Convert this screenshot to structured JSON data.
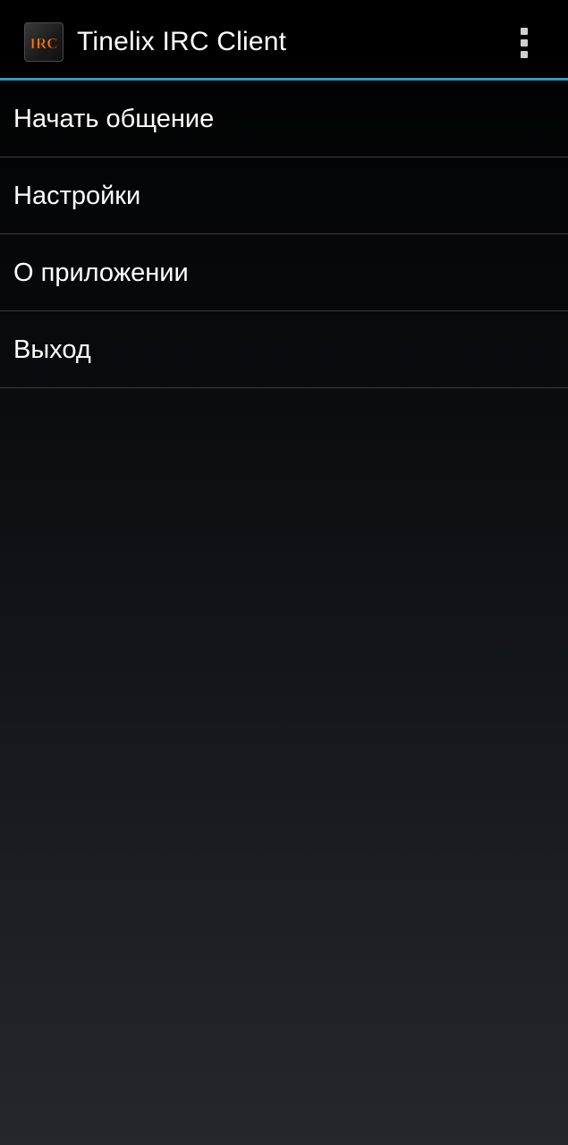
{
  "action_bar": {
    "title": "Tinelix IRC Client",
    "icon": "irc-logo-icon",
    "icon_text": "IRC",
    "overflow_icon": "more-vert-icon"
  },
  "colors": {
    "accent": "#33b5e5",
    "logo_text": "#f07a1a",
    "background_top": "#000000",
    "background_bottom": "#24272c"
  },
  "menu": {
    "items": [
      {
        "label": "Начать общение"
      },
      {
        "label": "Настройки"
      },
      {
        "label": "О приложении"
      },
      {
        "label": "Выход"
      }
    ]
  }
}
